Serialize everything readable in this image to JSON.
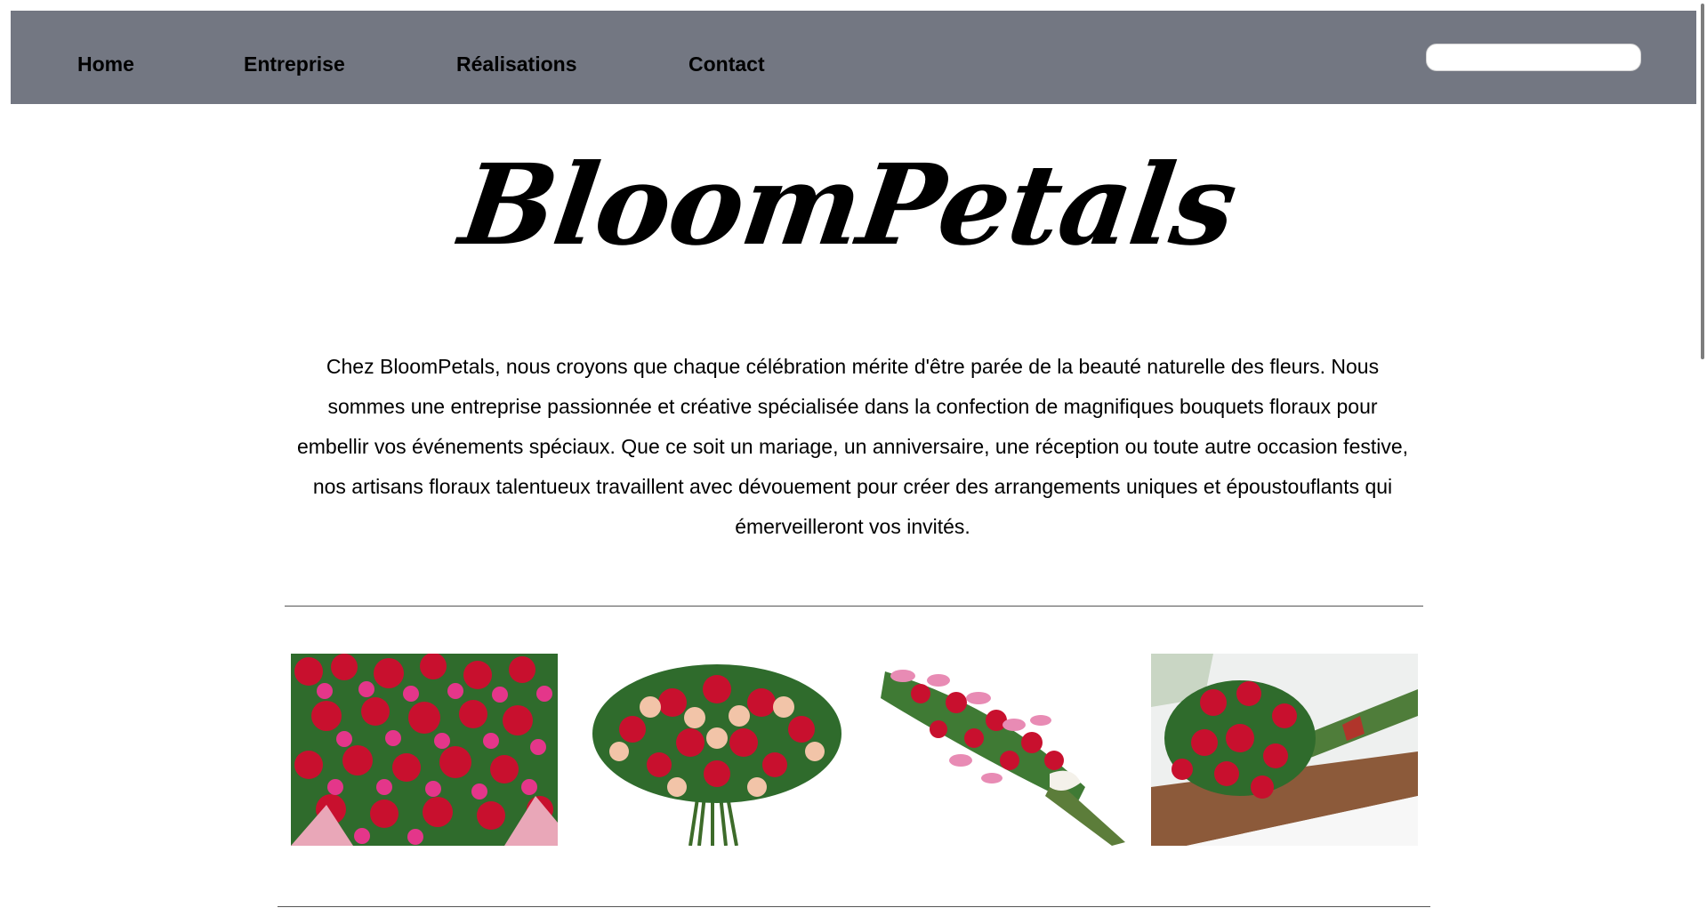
{
  "nav": {
    "items": [
      {
        "label": "Home"
      },
      {
        "label": "Entreprise"
      },
      {
        "label": "Réalisations"
      },
      {
        "label": "Contact"
      }
    ],
    "search": {
      "value": "",
      "placeholder": ""
    }
  },
  "logo": {
    "text": "BloomPetals"
  },
  "intro": {
    "text": "Chez BloomPetals, nous croyons que chaque célébration mérite d'être parée de la beauté naturelle des fleurs. Nous sommes une entreprise passionnée et créative spécialisée dans la confection de magnifiques bouquets floraux pour embellir vos événements spéciaux. Que ce soit un mariage, un anniversaire, une réception ou toute autre occasion festive, nos artisans floraux talentueux travaillent avec dévouement pour créer des arrangements uniques et époustouflants qui émerveilleront vos invités."
  },
  "gallery": {
    "images": [
      {
        "subject": "pink-red-roses-bouquet"
      },
      {
        "subject": "red-peach-roses-bouquet"
      },
      {
        "subject": "lily-rose-spray"
      },
      {
        "subject": "red-roses-on-table"
      }
    ]
  },
  "colors": {
    "navbar_bg": "#737782",
    "nav_text": "#000000",
    "page_bg": "#ffffff",
    "divider": "#555555"
  }
}
